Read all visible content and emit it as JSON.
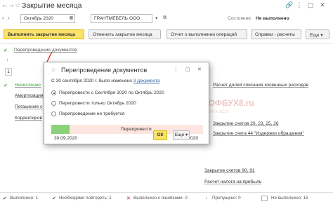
{
  "window": {
    "title": "Закрытие месяца"
  },
  "params": {
    "period": "Октябрь 2020",
    "organization": "ГРАНТМЕБЕЛЬ ООО",
    "status_label": "Состояние:",
    "status_value": "Не выполнено"
  },
  "toolbar": {
    "run": "Выполнить закрытие месяца",
    "cancel": "Отменить закрытие месяца",
    "report": "Отчет о выполнении операций",
    "help": "Справки - расчеты",
    "more": "Еще"
  },
  "left_list": {
    "step1": "Перепроведение документов",
    "step_num": "1",
    "item_accrual": "Начисление",
    "item_amort": "Амортизация",
    "item_repay": "Погашение с",
    "item_corr": "Корректиров"
  },
  "right_list": {
    "indirect": "Расчет долей списания косвенных расходов",
    "acc_20": "Закрытие счетов 20, 23, 25, 26",
    "acc_44": "Закрытие счета 44 \"Издержки обращения\"",
    "acc_90": "Закрытие счетов 90, 91",
    "tax": "Расчет налога на прибыль"
  },
  "dialog": {
    "title": "Перепроведение документов",
    "info": "С 30 сентября 2020 г. было изменено",
    "info_link": "3 документа",
    "option1": "Перепровести с Сентября 2020 по Октябрь 2020",
    "option2": "Перепровести только Октябрь 2020",
    "option3": "Перепроведение не требуется",
    "progress_label": "Перепровести",
    "progress_fraction": 0.12,
    "date_start": "30.09.2020",
    "date_end": "31.10.2020",
    "ok": "ОК"
  },
  "watermark": {
    "brand": "ПРОФБУХ8.ru",
    "sub": "онлайн-курсы по работе в 1С:8"
  },
  "status_bar": {
    "done": "Выполнено: 1",
    "repeat": "Необходимо повторить: 1",
    "errors": "Выполнено с ошибками: 0",
    "skipped": "Пропущено: 0",
    "not_done": "Не выполнено: 15"
  },
  "colors": {
    "accent_yellow": "#fbe36b",
    "success_green": "#3aa33a",
    "progress_green": "#8bd27a",
    "progress_pink": "#fde5e0"
  }
}
